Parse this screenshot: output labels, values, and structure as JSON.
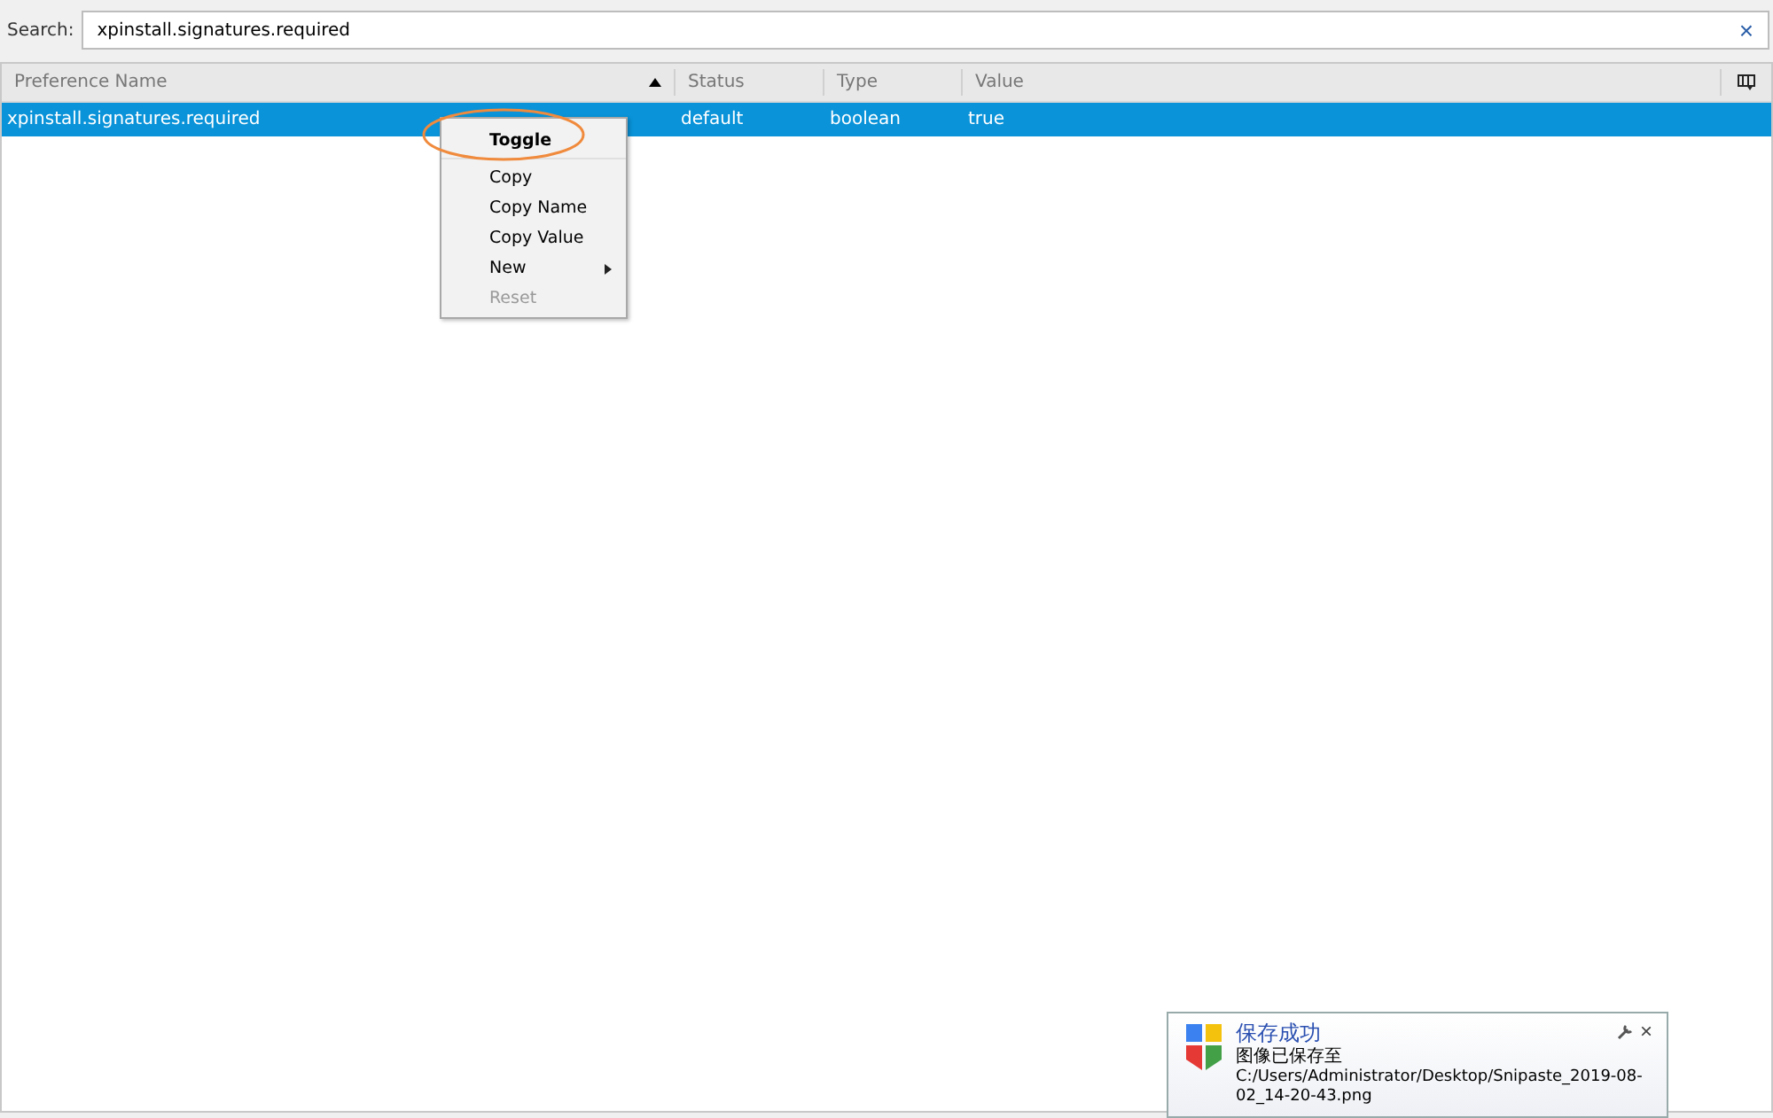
{
  "search": {
    "label": "Search:",
    "value": "xpinstall.signatures.required",
    "clear": "×"
  },
  "table": {
    "columns": [
      {
        "label": "Preference Name",
        "sorted": true
      },
      {
        "label": "Status",
        "sorted": false
      },
      {
        "label": "Type",
        "sorted": false
      },
      {
        "label": "Value",
        "sorted": false
      }
    ],
    "rows": [
      {
        "cells": [
          "xpinstall.signatures.required",
          "default",
          "boolean",
          "true"
        ],
        "selected": true
      }
    ]
  },
  "context_menu": {
    "items": [
      {
        "label": "Toggle",
        "default": true,
        "disabled": false,
        "submenu": false,
        "highlighted": true
      },
      {
        "label": "Copy",
        "default": false,
        "disabled": false,
        "submenu": false,
        "highlighted": false
      },
      {
        "label": "Copy Name",
        "default": false,
        "disabled": false,
        "submenu": false,
        "highlighted": false
      },
      {
        "label": "Copy Value",
        "default": false,
        "disabled": false,
        "submenu": false,
        "highlighted": false
      },
      {
        "label": "New",
        "default": false,
        "disabled": false,
        "submenu": true,
        "highlighted": false
      },
      {
        "label": "Reset",
        "default": false,
        "disabled": true,
        "submenu": false,
        "highlighted": false
      }
    ]
  },
  "notification": {
    "title": "保存成功",
    "message": "图像已保存至",
    "path": "C:/Users/Administrator/Desktop/Snipaste_2019-08-02_14-20-43.png",
    "close": "×"
  }
}
